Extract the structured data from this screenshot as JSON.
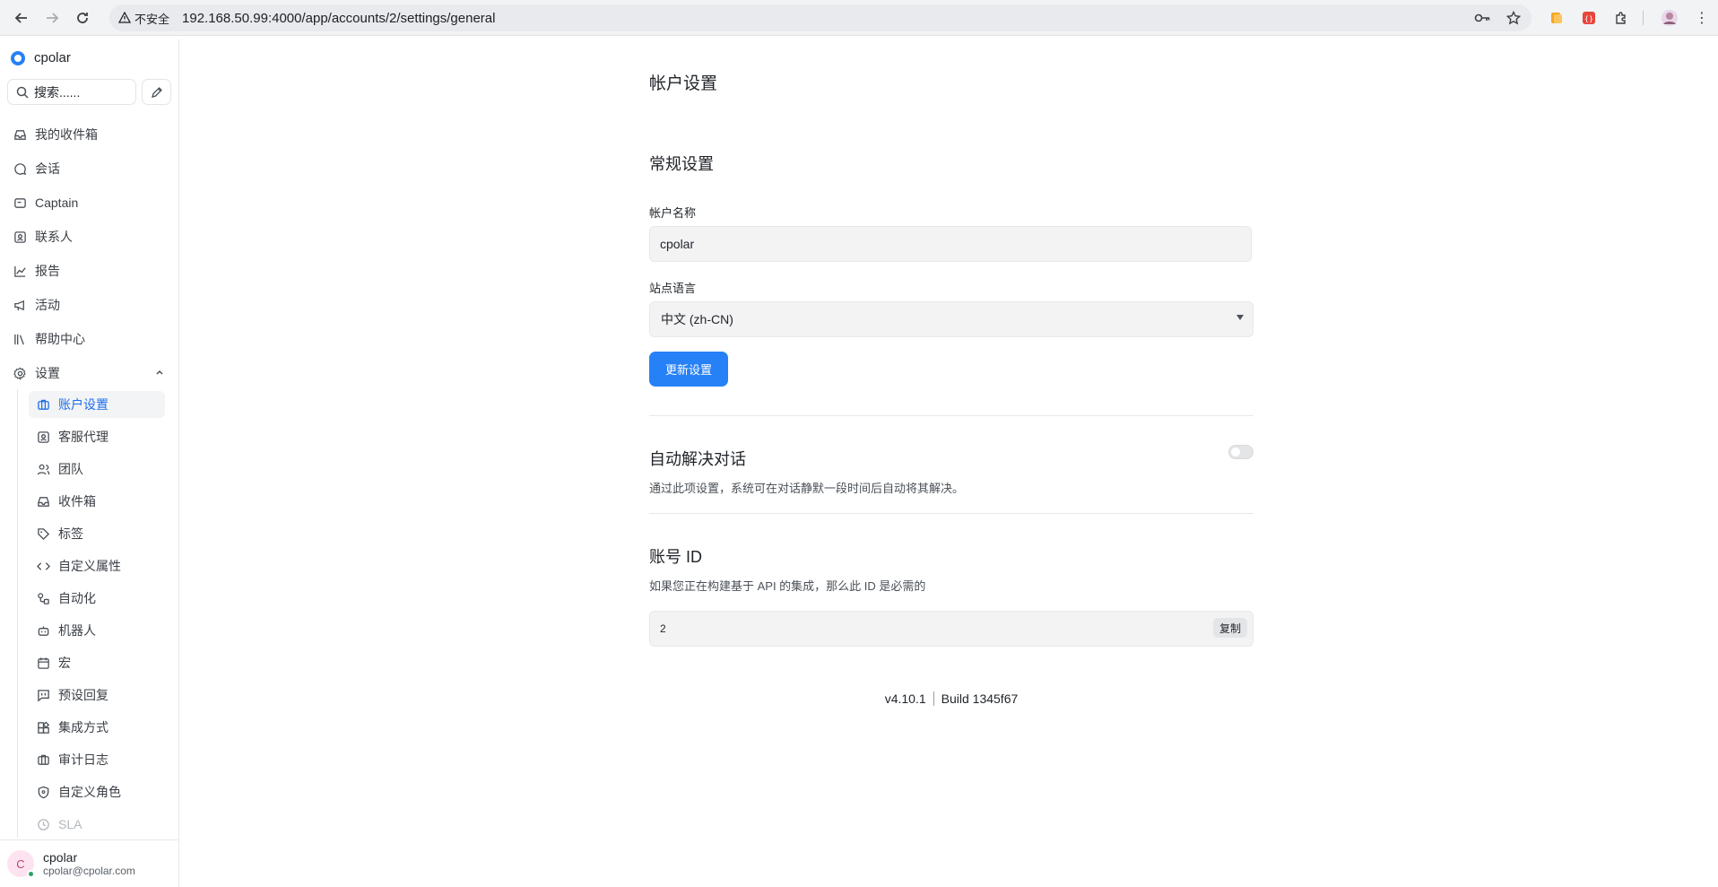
{
  "browser": {
    "insecure_label": "不安全",
    "url": "192.168.50.99:4000/app/accounts/2/settings/general"
  },
  "sidebar": {
    "brand": "cpolar",
    "search_placeholder": "搜索......",
    "nav": [
      {
        "label": "我的收件箱",
        "icon": "inbox-icon"
      },
      {
        "label": "会话",
        "icon": "chat-bubble-icon"
      },
      {
        "label": "Captain",
        "icon": "captain-icon"
      },
      {
        "label": "联系人",
        "icon": "contacts-icon"
      },
      {
        "label": "报告",
        "icon": "chart-line-icon"
      },
      {
        "label": "活动",
        "icon": "megaphone-icon"
      },
      {
        "label": "帮助中心",
        "icon": "library-icon"
      },
      {
        "label": "设置",
        "icon": "gear-icon"
      }
    ],
    "settings_items": [
      {
        "label": "账户设置",
        "icon": "briefcase-icon",
        "active": true
      },
      {
        "label": "客服代理",
        "icon": "agent-icon"
      },
      {
        "label": "团队",
        "icon": "team-icon"
      },
      {
        "label": "收件箱",
        "icon": "inbox-icon"
      },
      {
        "label": "标签",
        "icon": "tag-icon"
      },
      {
        "label": "自定义属性",
        "icon": "code-icon"
      },
      {
        "label": "自动化",
        "icon": "automation-icon"
      },
      {
        "label": "机器人",
        "icon": "bot-icon"
      },
      {
        "label": "宏",
        "icon": "calendar-icon"
      },
      {
        "label": "预设回复",
        "icon": "canned-reply-icon"
      },
      {
        "label": "集成方式",
        "icon": "integration-icon"
      },
      {
        "label": "审计日志",
        "icon": "audit-icon"
      },
      {
        "label": "自定义角色",
        "icon": "shield-icon"
      },
      {
        "label": "SLA",
        "icon": "clock-icon"
      }
    ],
    "user": {
      "initial": "C",
      "name": "cpolar",
      "email": "cpolar@cpolar.com"
    }
  },
  "main": {
    "page_title": "帐户设置",
    "general": {
      "title": "常规设置",
      "account_name_label": "帐户名称",
      "account_name_value": "cpolar",
      "language_label": "站点语言",
      "language_value": "中文 (zh-CN)",
      "update_button": "更新设置"
    },
    "auto_resolve": {
      "title": "自动解决对话",
      "description": "通过此项设置，系统可在对话静默一段时间后自动将其解决。",
      "enabled": false
    },
    "account_id": {
      "title": "账号 ID",
      "description": "如果您正在构建基于 API 的集成，那么此 ID 是必需的",
      "value": "2",
      "copy_button": "复制"
    },
    "version": "v4.10.1",
    "build": "Build 1345f67"
  },
  "colors": {
    "accent": "#2781f6",
    "active_text": "#1f6feb"
  }
}
